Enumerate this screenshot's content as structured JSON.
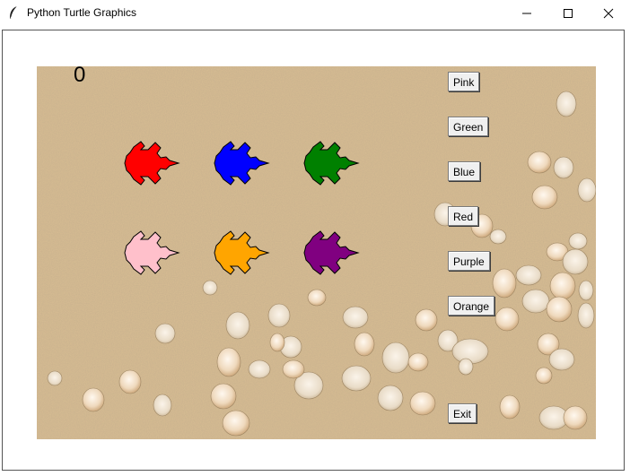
{
  "window": {
    "title": "Python Turtle Graphics",
    "controls": [
      "minimize-icon",
      "maximize-icon",
      "close-icon"
    ]
  },
  "canvas": {
    "score": "0",
    "background": "sand-with-seashells"
  },
  "buttons": {
    "pink": "Pink",
    "green": "Green",
    "blue": "Blue",
    "red": "Red",
    "purple": "Purple",
    "orange": "Orange",
    "exit": "Exit"
  },
  "turtles": [
    {
      "name": "red-turtle",
      "color": "#ff0000"
    },
    {
      "name": "blue-turtle",
      "color": "#0000ff"
    },
    {
      "name": "green-turtle",
      "color": "#008000"
    },
    {
      "name": "pink-turtle",
      "color": "#ffc0cb"
    },
    {
      "name": "orange-turtle",
      "color": "#ffa500"
    },
    {
      "name": "purple-turtle",
      "color": "#800080"
    }
  ]
}
